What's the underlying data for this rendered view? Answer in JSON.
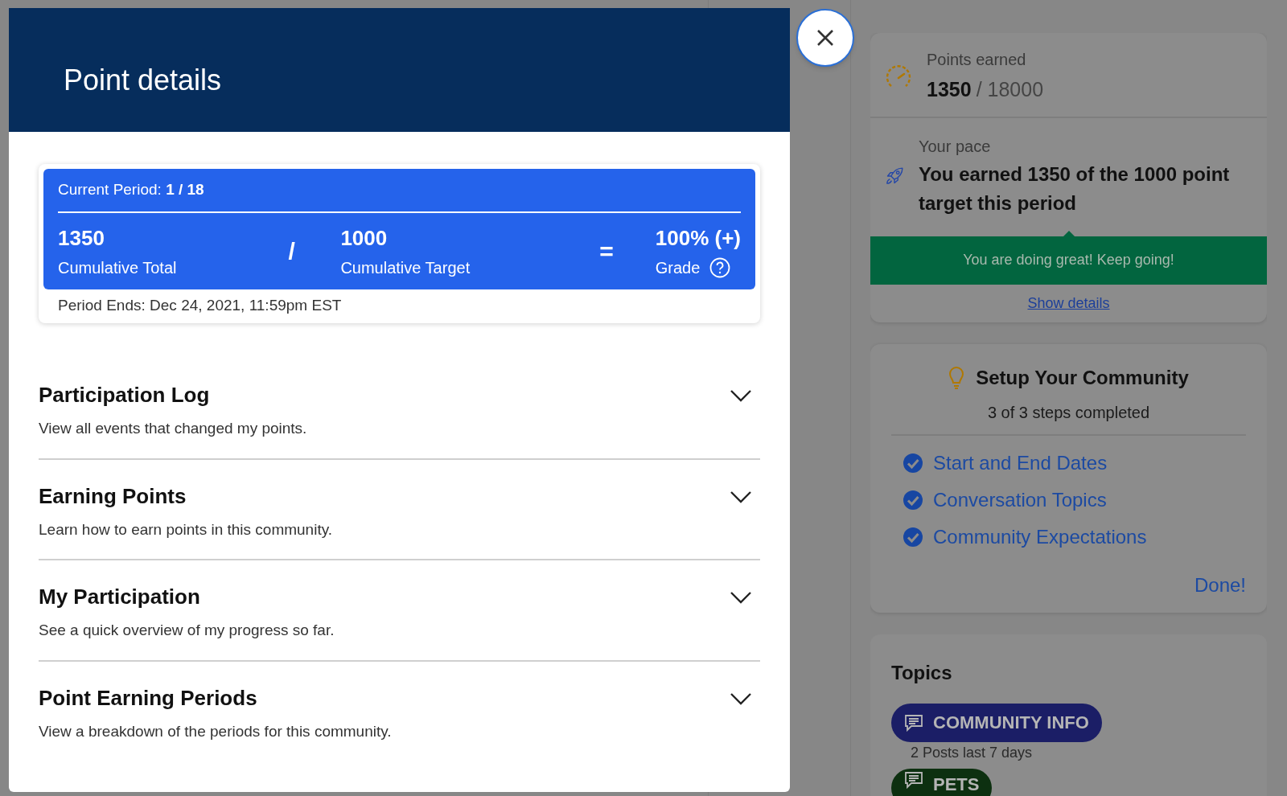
{
  "modal": {
    "title": "Point details",
    "period": {
      "current": "Current Period: **1 / 18**",
      "stats": [
        {
          "value": "1350",
          "label": "Cumulative Total",
          "help": false
        },
        {
          "value": "1000",
          "label": "Cumulative Target",
          "help": false
        },
        {
          "value": "100% (+)",
          "label": "Grade",
          "help": true
        }
      ],
      "operators": [
        "/",
        "="
      ],
      "ends": "Period Ends: Dec 24, 2021, 11:59pm EST"
    },
    "sections": [
      {
        "title": "Participation Log",
        "description": "View all events that changed my points.",
        "expanded": false
      },
      {
        "title": "Earning Points",
        "description": "Learn how to earn points in this community.",
        "expanded": false
      },
      {
        "title": "My Participation",
        "description": "See a quick overview of my progress so far.",
        "expanded": false
      },
      {
        "title": "Point Earning Periods",
        "description": "View a breakdown of the periods for this community.",
        "expanded": false
      }
    ]
  },
  "sidebar": {
    "points": {
      "label": "Points earned",
      "earned": "1350",
      "total": "/ 18000"
    },
    "pace": {
      "label": "Your pace",
      "text": "You earned 1350 of the 1000 point target this period",
      "banner": "You are doing great! Keep going!",
      "link": "Show details"
    },
    "setup": {
      "title": "Setup Your Community",
      "progress": "3 of 3 steps completed",
      "steps": [
        {
          "label": "Start and End Dates",
          "checked": true
        },
        {
          "label": "Conversation Topics",
          "checked": true
        },
        {
          "label": "Community Expectations",
          "checked": true
        }
      ],
      "done": "Done!"
    },
    "topics": {
      "title": "Topics",
      "items": [
        {
          "label": "COMMUNITY INFO",
          "color": "#1b1e66",
          "posts": "2 Posts last 7 days"
        },
        {
          "label": "PETS",
          "color": "#0d3010"
        }
      ]
    }
  }
}
